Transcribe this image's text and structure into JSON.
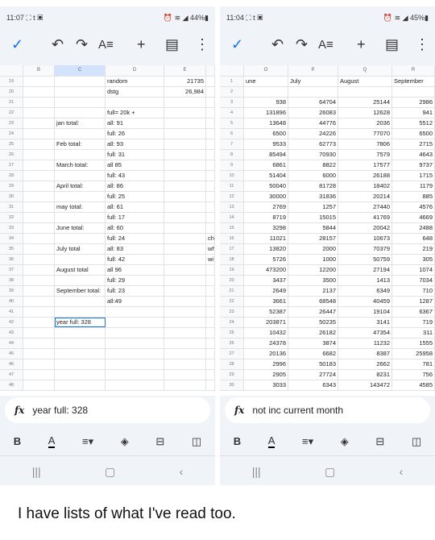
{
  "left": {
    "status": {
      "time": "11:07",
      "icons": "t",
      "battery": "44%"
    },
    "columns": [
      "",
      "B",
      "C",
      "D",
      "E",
      ""
    ],
    "rows": [
      [
        "19",
        "",
        "",
        "random",
        "21735",
        ""
      ],
      [
        "20",
        "",
        "",
        "dstg",
        "26,984",
        ""
      ],
      [
        "21",
        "",
        "",
        "",
        "",
        ""
      ],
      [
        "22",
        "",
        "",
        "full= 20k +",
        "",
        ""
      ],
      [
        "23",
        "",
        "jan total:",
        "all: 91",
        "",
        ""
      ],
      [
        "24",
        "",
        "",
        "full: 26",
        "",
        ""
      ],
      [
        "25",
        "",
        "Feb total:",
        "all: 93",
        "",
        ""
      ],
      [
        "26",
        "",
        "",
        "full: 31",
        "",
        ""
      ],
      [
        "27",
        "",
        "March total:",
        "all 85",
        "",
        ""
      ],
      [
        "28",
        "",
        "",
        "full: 43",
        "",
        ""
      ],
      [
        "29",
        "",
        "April total:",
        "all: 86",
        "",
        ""
      ],
      [
        "30",
        "",
        "",
        "full: 25",
        "",
        ""
      ],
      [
        "31",
        "",
        "may total:",
        "all: 61",
        "",
        ""
      ],
      [
        "32",
        "",
        "",
        "full: 17",
        "",
        ""
      ],
      [
        "33",
        "",
        "June total:",
        "all: 60",
        "",
        ""
      ],
      [
        "34",
        "",
        "",
        "full: 24",
        "",
        "ch"
      ],
      [
        "35",
        "",
        "July total",
        "all: 83",
        "",
        "wh"
      ],
      [
        "36",
        "",
        "",
        "full: 42",
        "",
        "wi"
      ],
      [
        "37",
        "",
        "August total",
        "all 96",
        "",
        ""
      ],
      [
        "38",
        "",
        "",
        "full: 29",
        "",
        ""
      ],
      [
        "39",
        "",
        "September total:",
        "full: 23",
        "",
        ""
      ],
      [
        "40",
        "",
        "",
        "all:49",
        "",
        ""
      ],
      [
        "41",
        "",
        "",
        "",
        "",
        ""
      ],
      [
        "42",
        "",
        "year full: 328",
        "",
        "",
        ""
      ],
      [
        "43",
        "",
        "",
        "",
        "",
        ""
      ],
      [
        "44",
        "",
        "",
        "",
        "",
        ""
      ],
      [
        "45",
        "",
        "",
        "",
        "",
        ""
      ],
      [
        "46",
        "",
        "",
        "",
        "",
        ""
      ],
      [
        "47",
        "",
        "",
        "",
        "",
        ""
      ],
      [
        "48",
        "",
        "",
        "",
        "",
        ""
      ]
    ],
    "formula": "year full: 328"
  },
  "right": {
    "status": {
      "time": "11:04",
      "icons": "t",
      "battery": "45%"
    },
    "columns": [
      "",
      "O",
      "P",
      "Q",
      "R"
    ],
    "rows": [
      [
        "1",
        "une",
        "July",
        "August",
        "September"
      ],
      [
        "2",
        "",
        "",
        "",
        ""
      ],
      [
        "3",
        "938",
        "64704",
        "25144",
        "2986"
      ],
      [
        "4",
        "131896",
        "26083",
        "12628",
        "941"
      ],
      [
        "5",
        "13648",
        "44776",
        "2036",
        "5512"
      ],
      [
        "6",
        "6500",
        "24226",
        "77070",
        "6500"
      ],
      [
        "7",
        "9533",
        "62773",
        "7806",
        "2715"
      ],
      [
        "8",
        "85494",
        "70930",
        "7579",
        "4643"
      ],
      [
        "9",
        "6861",
        "8822",
        "17577",
        "9737"
      ],
      [
        "10",
        "51404",
        "6000",
        "26188",
        "1715"
      ],
      [
        "11",
        "50040",
        "81728",
        "18402",
        "1179"
      ],
      [
        "12",
        "30000",
        "31836",
        "20214",
        "885"
      ],
      [
        "13",
        "2769",
        "1257",
        "27440",
        "4576"
      ],
      [
        "14",
        "8719",
        "15015",
        "41769",
        "4669"
      ],
      [
        "15",
        "3298",
        "5844",
        "20042",
        "2488"
      ],
      [
        "16",
        "11021",
        "28157",
        "10673",
        "648"
      ],
      [
        "17",
        "13820",
        "2000",
        "70379",
        "219"
      ],
      [
        "18",
        "5726",
        "1000",
        "50759",
        "305"
      ],
      [
        "19",
        "473200",
        "12200",
        "27194",
        "1074"
      ],
      [
        "20",
        "3437",
        "3500",
        "1413",
        "7034"
      ],
      [
        "21",
        "2649",
        "2137",
        "6349",
        "710"
      ],
      [
        "22",
        "3661",
        "68548",
        "40459",
        "1287"
      ],
      [
        "23",
        "52387",
        "26447",
        "19104",
        "6367"
      ],
      [
        "24",
        "203871",
        "50235",
        "3141",
        "719"
      ],
      [
        "25",
        "10432",
        "26182",
        "47354",
        "311"
      ],
      [
        "26",
        "24378",
        "3874",
        "11232",
        "1555"
      ],
      [
        "27",
        "20136",
        "6682",
        "8387",
        "25958"
      ],
      [
        "28",
        "2996",
        "50183",
        "2662",
        "781"
      ],
      [
        "29",
        "2905",
        "27724",
        "8231",
        "756"
      ],
      [
        "30",
        "3033",
        "6343",
        "143472",
        "4585"
      ]
    ],
    "formula": "not inc current month"
  },
  "toolbar": {
    "fx": "fx",
    "bold": "B",
    "text_color": "A",
    "font_format": "A≡"
  },
  "caption": "I have lists of what I've read too.",
  "colors": {
    "accent": "#1a73e8",
    "selected_header": "#d3e3fd",
    "chrome": "#f0f4f9"
  }
}
